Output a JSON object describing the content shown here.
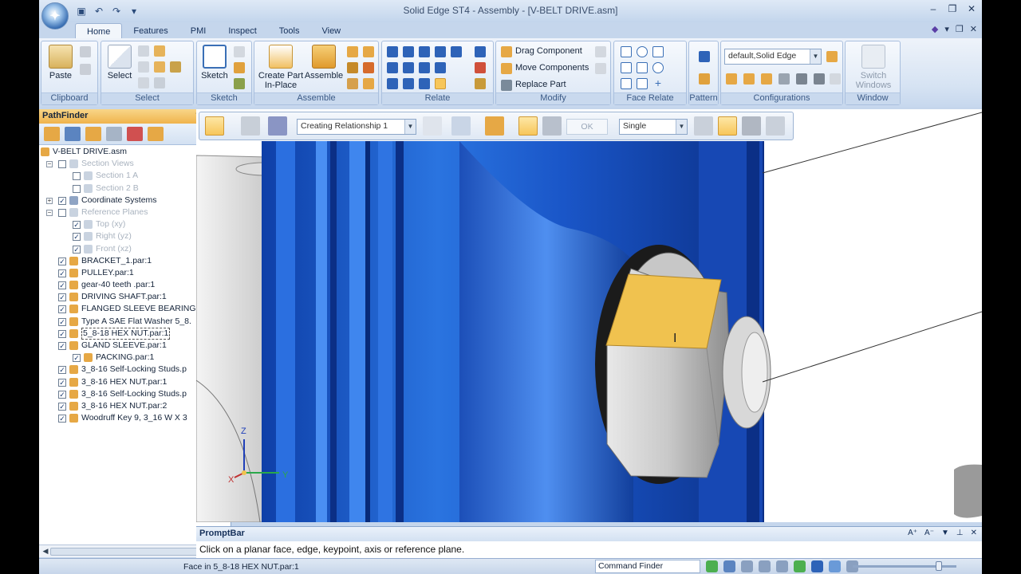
{
  "window": {
    "title": "Solid Edge ST4 - Assembly - [V-BELT DRIVE.asm]"
  },
  "ribbon_tabs": [
    "Home",
    "Features",
    "PMI",
    "Inspect",
    "Tools",
    "View"
  ],
  "ribbon": {
    "clipboard": {
      "title": "Clipboard",
      "paste": "Paste"
    },
    "select": {
      "title": "Select",
      "select": "Select"
    },
    "sketch": {
      "title": "Sketch",
      "sketch": "Sketch"
    },
    "assemble": {
      "title": "Assemble",
      "create_part_1": "Create Part",
      "create_part_2": "In-Place",
      "assemble": "Assemble"
    },
    "relate": {
      "title": "Relate"
    },
    "modify": {
      "title": "Modify",
      "drag": "Drag Component",
      "move": "Move Components",
      "replace": "Replace Part"
    },
    "face_relate": {
      "title": "Face Relate"
    },
    "pattern": {
      "title": "Pattern"
    },
    "configurations": {
      "title": "Configurations",
      "value": "default,Solid Edge"
    },
    "window": {
      "title": "Window",
      "switch_1": "Switch",
      "switch_2": "Windows"
    }
  },
  "pathfinder": {
    "title": "PathFinder",
    "tree": [
      {
        "label": "V-BELT DRIVE.asm",
        "dim": false,
        "indent": 0,
        "expander": "",
        "checked": null,
        "icon": "assembly-icon"
      },
      {
        "label": "Section Views",
        "dim": true,
        "indent": 1,
        "expander": "−",
        "checked": false,
        "icon": "section-views-icon"
      },
      {
        "label": "Section 1 A",
        "dim": true,
        "indent": 2,
        "expander": "",
        "checked": false,
        "icon": "section-icon"
      },
      {
        "label": "Section 2 B",
        "dim": true,
        "indent": 2,
        "expander": "",
        "checked": false,
        "icon": "section-icon"
      },
      {
        "label": "Coordinate Systems",
        "dim": false,
        "indent": 1,
        "expander": "+",
        "checked": true,
        "icon": "coordinate-system-icon"
      },
      {
        "label": "Reference Planes",
        "dim": true,
        "indent": 1,
        "expander": "−",
        "checked": false,
        "icon": "reference-planes-icon"
      },
      {
        "label": "Top (xy)",
        "dim": true,
        "indent": 2,
        "expander": "",
        "checked": true,
        "icon": "plane-icon"
      },
      {
        "label": "Right (yz)",
        "dim": true,
        "indent": 2,
        "expander": "",
        "checked": true,
        "icon": "plane-icon"
      },
      {
        "label": "Front (xz)",
        "dim": true,
        "indent": 2,
        "expander": "",
        "checked": true,
        "icon": "plane-icon"
      },
      {
        "label": "BRACKET_1.par:1",
        "dim": false,
        "indent": 1,
        "expander": "",
        "checked": true,
        "icon": "part-icon"
      },
      {
        "label": "PULLEY.par:1",
        "dim": false,
        "indent": 1,
        "expander": "",
        "checked": true,
        "icon": "part-icon"
      },
      {
        "label": "gear-40 teeth .par:1",
        "dim": false,
        "indent": 1,
        "expander": "",
        "checked": true,
        "icon": "part-icon"
      },
      {
        "label": "DRIVING SHAFT.par:1",
        "dim": false,
        "indent": 1,
        "expander": "",
        "checked": true,
        "icon": "part-icon"
      },
      {
        "label": "FLANGED SLEEVE BEARING.p",
        "dim": false,
        "indent": 1,
        "expander": "",
        "checked": true,
        "icon": "part-icon"
      },
      {
        "label": "Type A SAE Flat Washer 5_8.",
        "dim": false,
        "indent": 1,
        "expander": "",
        "checked": true,
        "icon": "part-icon"
      },
      {
        "label": "5_8-18 HEX NUT.par:1",
        "dim": false,
        "indent": 1,
        "expander": "",
        "checked": true,
        "icon": "part-icon",
        "selected": true
      },
      {
        "label": "GLAND SLEEVE.par:1",
        "dim": false,
        "indent": 1,
        "expander": "",
        "checked": true,
        "icon": "part-icon"
      },
      {
        "label": "PACKING.par:1",
        "dim": false,
        "indent": 2,
        "expander": "",
        "checked": true,
        "icon": "part-icon"
      },
      {
        "label": "3_8-16 Self-Locking Studs.p",
        "dim": false,
        "indent": 1,
        "expander": "",
        "checked": true,
        "icon": "part-icon"
      },
      {
        "label": "3_8-16 HEX NUT.par:1",
        "dim": false,
        "indent": 1,
        "expander": "",
        "checked": true,
        "icon": "part-icon"
      },
      {
        "label": "3_8-16 Self-Locking Studs.p",
        "dim": false,
        "indent": 1,
        "expander": "",
        "checked": true,
        "icon": "part-icon"
      },
      {
        "label": "3_8-16 HEX NUT.par:2",
        "dim": false,
        "indent": 1,
        "expander": "",
        "checked": true,
        "icon": "part-icon"
      },
      {
        "label": "Woodruff Key 9, 3_16 W X 3",
        "dim": false,
        "indent": 1,
        "expander": "",
        "checked": true,
        "icon": "part-icon"
      }
    ]
  },
  "command_bar": {
    "relationship": "Creating Relationship 1",
    "ok": "OK",
    "mode": "Single"
  },
  "triad": {
    "x": "X",
    "y": "Y",
    "z": "Z"
  },
  "promptbar": {
    "title": "PromptBar",
    "text": "Click on a planar face, edge, keypoint, axis or reference plane."
  },
  "status": {
    "message": "Face in 5_8-18 HEX NUT.par:1",
    "command_finder": "Command Finder"
  },
  "colors": {
    "accent": "#f3b94b",
    "model_blue": "#1d5fd0",
    "highlight_face": "#f0c24f"
  }
}
